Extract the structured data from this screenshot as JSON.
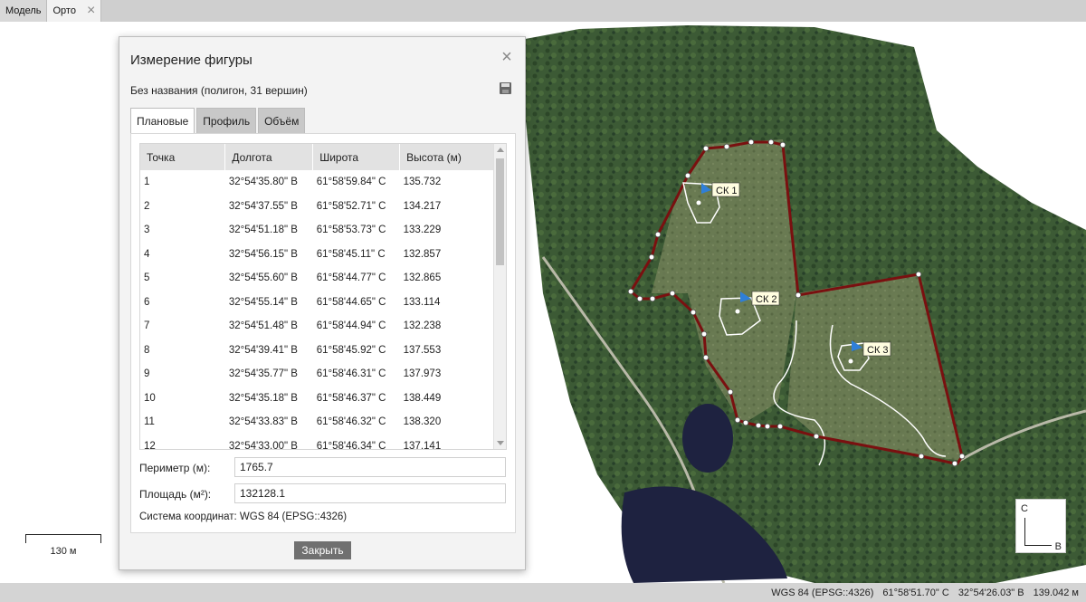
{
  "tabs": [
    {
      "label": "Модель",
      "active": false
    },
    {
      "label": "Орто",
      "active": true
    }
  ],
  "map": {
    "polygon_labels": [
      "СК 1",
      "СК 2",
      "СК 3"
    ],
    "scale_label": "130 м",
    "compass": {
      "north": "С",
      "east": "В"
    },
    "colors": {
      "polygon_outline": "#7a1010",
      "vertex": "#ffffff",
      "marker": "#2f7fd8",
      "forest": "#3a5a33",
      "water": "#1e2240"
    }
  },
  "dialog": {
    "title": "Измерение фигуры",
    "subtitle": "Без названия (полигон, 31 вершин)",
    "tabs": [
      "Плановые",
      "Профиль",
      "Объём"
    ],
    "active_tab": "Плановые",
    "table": {
      "headers": [
        "Точка",
        "Долгота",
        "Широта",
        "Высота (м)"
      ],
      "rows": [
        [
          "1",
          "32°54'35.80\" В",
          "61°58'59.84\" С",
          "135.732"
        ],
        [
          "2",
          "32°54'37.55\" В",
          "61°58'52.71\" С",
          "134.217"
        ],
        [
          "3",
          "32°54'51.18\" В",
          "61°58'53.73\" С",
          "133.229"
        ],
        [
          "4",
          "32°54'56.15\" В",
          "61°58'45.11\" С",
          "132.857"
        ],
        [
          "5",
          "32°54'55.60\" В",
          "61°58'44.77\" С",
          "132.865"
        ],
        [
          "6",
          "32°54'55.14\" В",
          "61°58'44.65\" С",
          "133.114"
        ],
        [
          "7",
          "32°54'51.48\" В",
          "61°58'44.94\" С",
          "132.238"
        ],
        [
          "8",
          "32°54'39.41\" В",
          "61°58'45.92\" С",
          "137.553"
        ],
        [
          "9",
          "32°54'35.77\" В",
          "61°58'46.31\" С",
          "137.973"
        ],
        [
          "10",
          "32°54'35.18\" В",
          "61°58'46.37\" С",
          "138.449"
        ],
        [
          "11",
          "32°54'33.83\" В",
          "61°58'46.32\" С",
          "138.320"
        ],
        [
          "12",
          "32°54'33.00\" В",
          "61°58'46.34\" С",
          "137.141"
        ]
      ]
    },
    "perimeter_label": "Периметр (м):",
    "perimeter_value": "1765.7",
    "area_label": "Площадь (м²):",
    "area_value": "132128.1",
    "crs_label": "Система координат:",
    "crs_value": "WGS 84 (EPSG::4326)",
    "close_button": "Закрыть"
  },
  "status": {
    "crs": "WGS 84 (EPSG::4326)",
    "lat": "61°58'51.70\" С",
    "lon": "32°54'26.03\" В",
    "alt": "139.042 м"
  }
}
